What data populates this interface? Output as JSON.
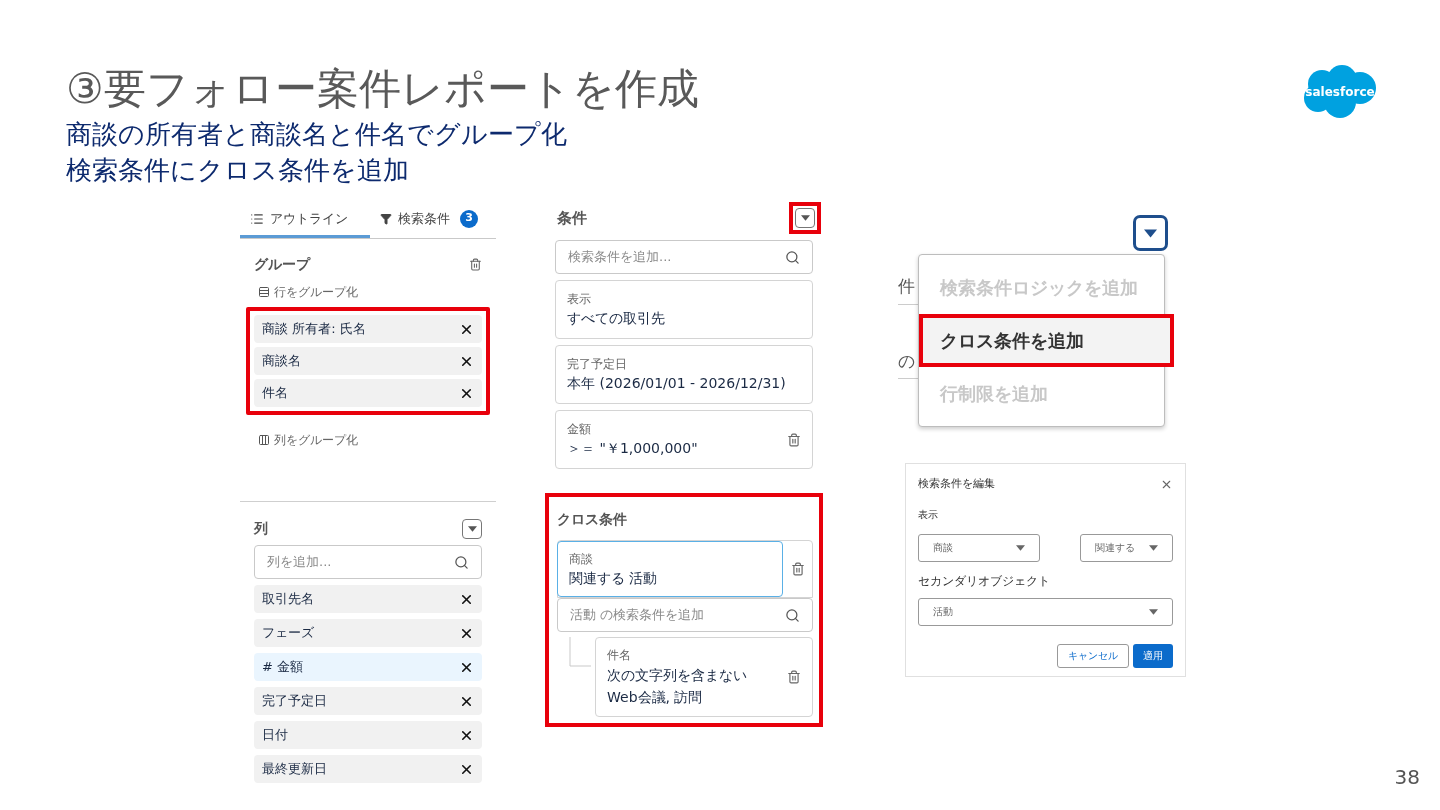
{
  "slide": {
    "title": "③要フォロー案件レポートを作成",
    "subtitles": [
      "商談の所有者と商談名と件名でグループ化",
      "検索条件にクロス条件を追加"
    ],
    "logo": "salesforce",
    "page_number": "38"
  },
  "outline_panel": {
    "tabs": [
      {
        "label": "アウトライン",
        "kind": "outline",
        "selected": true
      },
      {
        "label": "検索条件",
        "kind": "filter",
        "selected": false,
        "badge": "3"
      }
    ],
    "group": {
      "title": "グループ",
      "row_group_label": "行をグループ化",
      "highlighted": true,
      "rows": [
        "商談 所有者: 氏名",
        "商談名",
        "件名"
      ],
      "column_group_label": "列をグループ化"
    },
    "columns": {
      "title": "列",
      "search_placeholder": "列を追加...",
      "items": [
        {
          "label": "取引先名",
          "selected": false
        },
        {
          "label": "フェーズ",
          "selected": false
        },
        {
          "label": "# 金額",
          "selected": true
        },
        {
          "label": "完了予定日",
          "selected": false
        },
        {
          "label": "日付",
          "selected": false
        },
        {
          "label": "最終更新日",
          "selected": false
        }
      ]
    }
  },
  "filters_panel": {
    "title": "条件",
    "menu_button_highlighted": true,
    "search_placeholder": "検索条件を追加...",
    "filters": [
      {
        "label": "表示",
        "value": "すべての取引先",
        "deletable": false
      },
      {
        "label": "完了予定日",
        "value": "本年 (2026/01/01 - 2026/12/31)",
        "deletable": false
      },
      {
        "label": "金額",
        "value": "＞＝ \"￥1,000,000\"",
        "deletable": true
      }
    ],
    "cross": {
      "title": "クロス条件",
      "highlighted": true,
      "object": "商談",
      "relation": "関連する 活動",
      "search_placeholder": "活動 の検索条件を追加",
      "sub_filters": [
        {
          "label": "件名",
          "values": [
            "次の文字列を含まない",
            "Web会議, 訪問"
          ]
        }
      ]
    }
  },
  "menu": {
    "fragments": [
      "件",
      "の"
    ],
    "items": [
      {
        "label": "検索条件ロジックを追加",
        "disabled": true,
        "selected": false,
        "highlighted": false
      },
      {
        "label": "クロス条件を追加",
        "disabled": false,
        "selected": true,
        "highlighted": true
      },
      {
        "label": "行制限を追加",
        "disabled": true,
        "selected": false,
        "highlighted": false
      }
    ]
  },
  "dialog": {
    "title": "検索条件を編集",
    "show_label": "表示",
    "object": "商談",
    "relation": "関連する",
    "secondary_label": "セカンダリオブジェクト",
    "secondary": "活動",
    "buttons": [
      {
        "label": "キャンセル",
        "kind": "secondary"
      },
      {
        "label": "適用",
        "kind": "primary"
      }
    ]
  }
}
